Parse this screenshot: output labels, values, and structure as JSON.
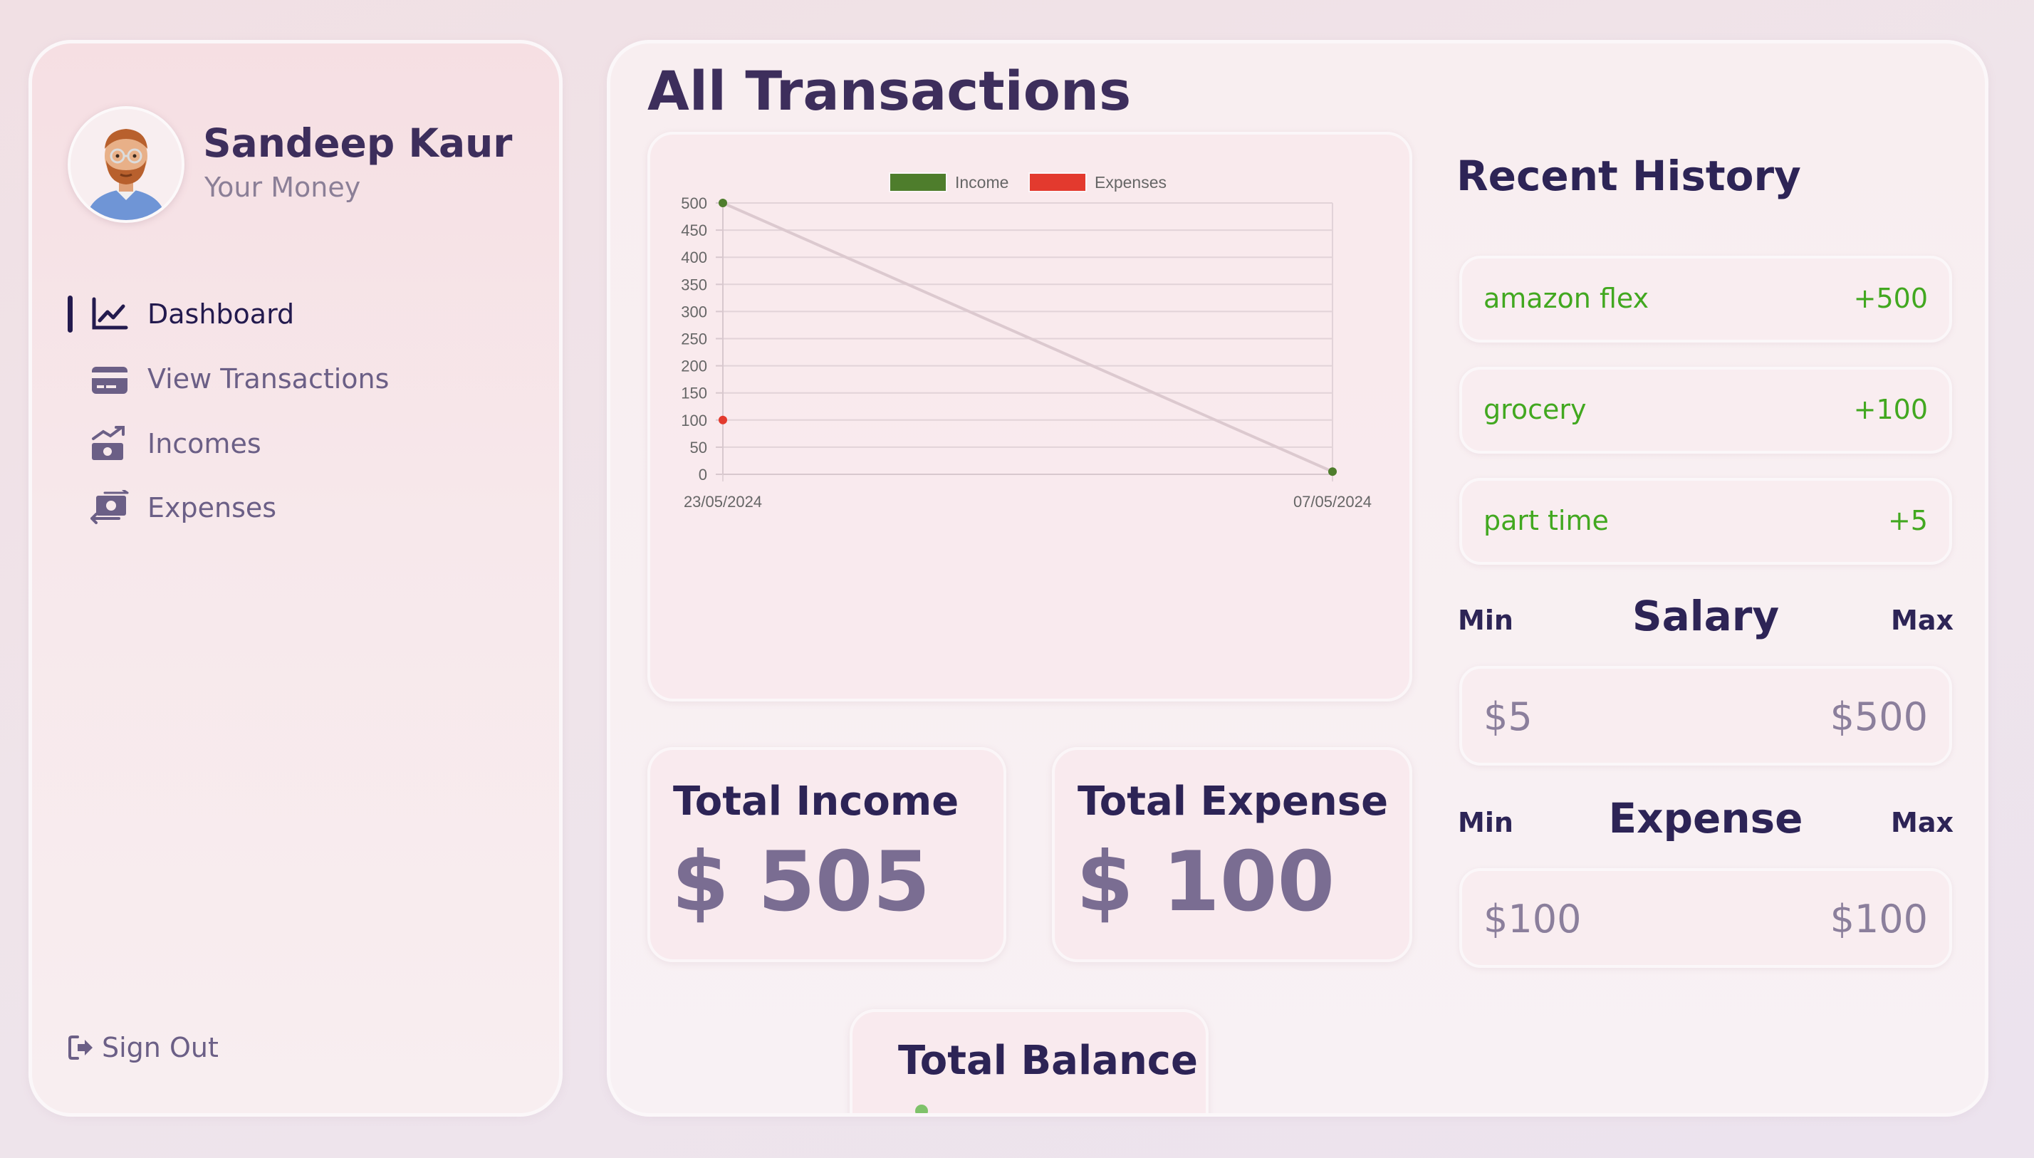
{
  "profile": {
    "name": "Sandeep Kaur",
    "subtitle": "Your Money"
  },
  "nav": {
    "items": [
      {
        "label": "Dashboard",
        "icon": "line-chart-icon",
        "active": true
      },
      {
        "label": "View Transactions",
        "icon": "credit-card-icon",
        "active": false
      },
      {
        "label": "Incomes",
        "icon": "money-bill-trend-up-icon",
        "active": false
      },
      {
        "label": "Expenses",
        "icon": "money-bill-transfer-icon",
        "active": false
      }
    ],
    "signout": "Sign Out"
  },
  "main": {
    "title": "All Transactions",
    "total_income": {
      "title": "Total Income",
      "value": "$ 505"
    },
    "total_expense": {
      "title": "Total Expense",
      "value": "$ 100"
    },
    "total_balance": {
      "title": "Total Balance"
    }
  },
  "history": {
    "title": "Recent History",
    "items": [
      {
        "name": "amazon flex",
        "amount": "+500"
      },
      {
        "name": "grocery",
        "amount": "+100"
      },
      {
        "name": "part time",
        "amount": "+5"
      }
    ]
  },
  "salary": {
    "title": "Salary",
    "min_label": "Min",
    "max_label": "Max",
    "min": "$5",
    "max": "$500"
  },
  "expense": {
    "title": "Expense",
    "min_label": "Min",
    "max_label": "Max",
    "min": "$100",
    "max": "$100"
  },
  "colors": {
    "income": "#4e7d2c",
    "expenses": "#e33a2e",
    "accent": "#231a4e",
    "history_text": "#42a820"
  },
  "chart_data": {
    "type": "line",
    "x": [
      "23/05/2024",
      "07/05/2024"
    ],
    "series": [
      {
        "name": "Income",
        "values": [
          500,
          5
        ],
        "color": "#4e7d2c"
      },
      {
        "name": "Expenses",
        "values": [
          100
        ],
        "color": "#e33a2e"
      }
    ],
    "ylim": [
      0,
      500
    ],
    "yticks": [
      0,
      50,
      100,
      150,
      200,
      250,
      300,
      350,
      400,
      450,
      500
    ],
    "grid": true,
    "legend": "top"
  }
}
